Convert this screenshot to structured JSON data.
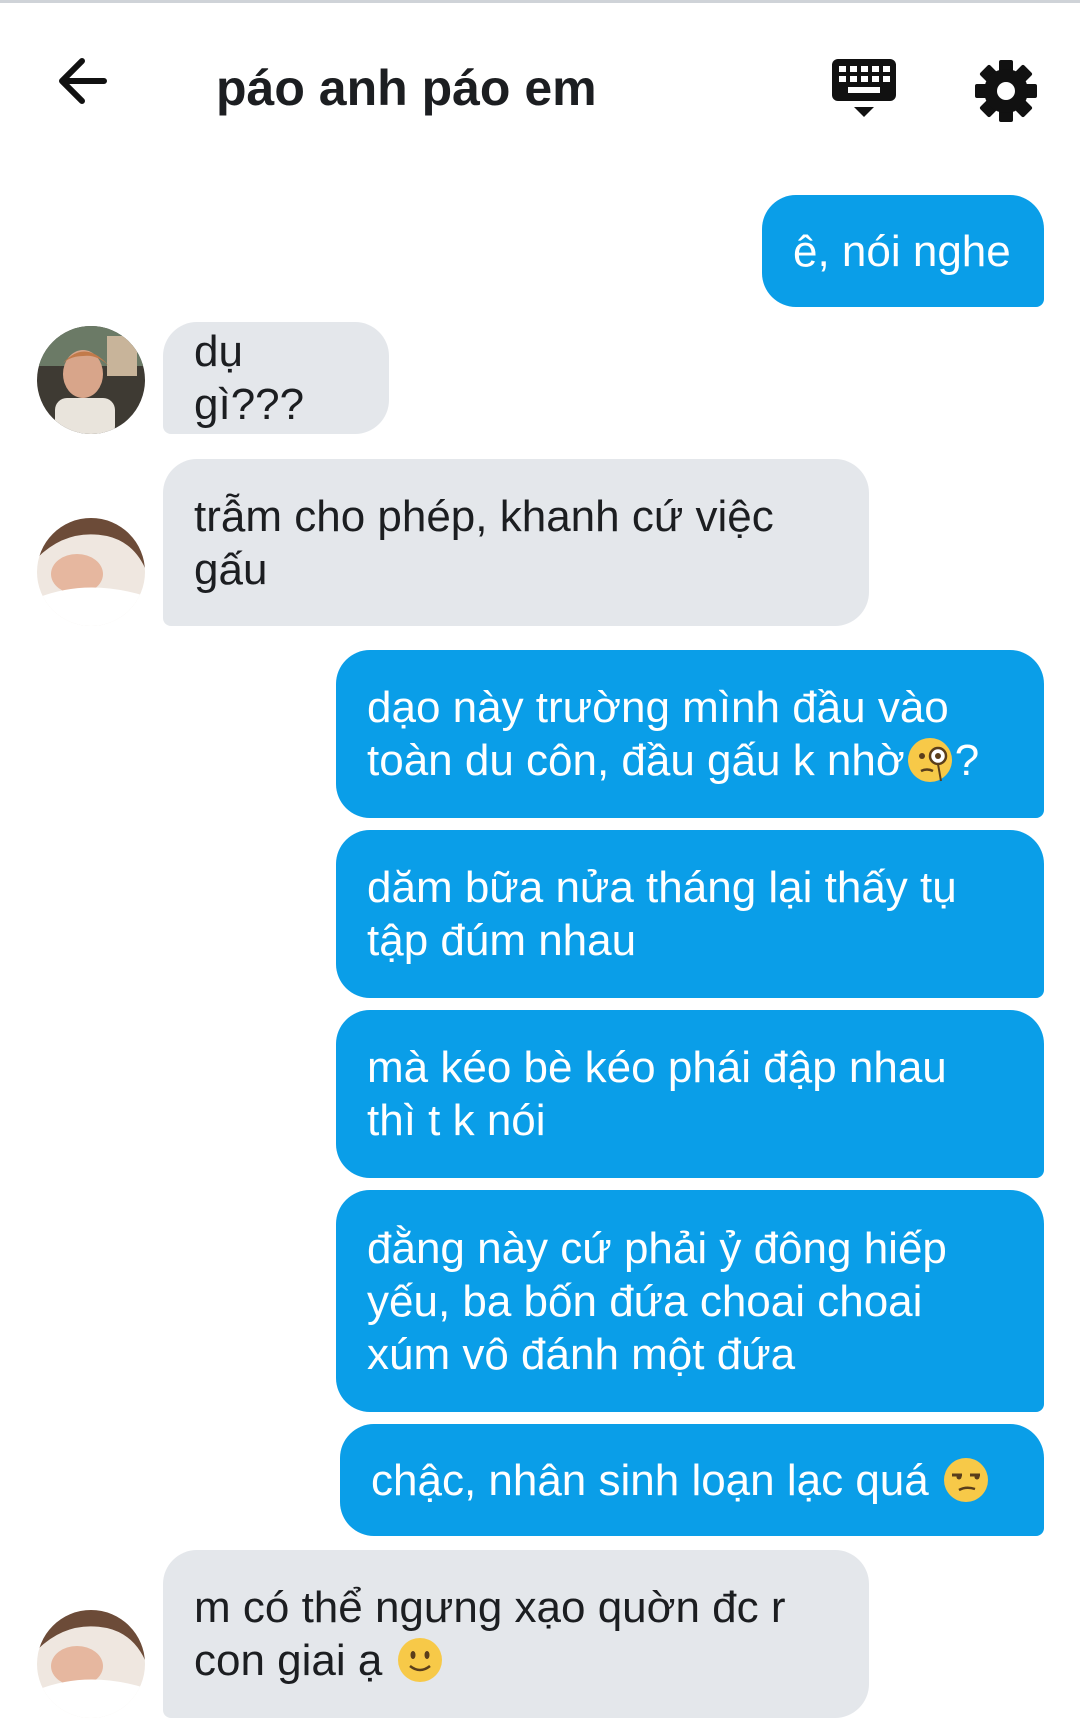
{
  "header": {
    "title": "páo anh páo em",
    "back_icon": "arrow-left-icon",
    "keyboard_icon": "keyboard-icon",
    "settings_icon": "gear-icon"
  },
  "colors": {
    "outgoing_bubble": "#0a9ee8",
    "incoming_bubble": "#e4e7eb"
  },
  "messages": [
    {
      "side": "out",
      "text": "ê, nói nghe"
    },
    {
      "side": "in",
      "text": "dụ gì???"
    },
    {
      "side": "in",
      "text": "trẫm cho phép, khanh cứ việc\ngấu"
    },
    {
      "side": "out",
      "text": "dạo này trường mình đầu vào\ntoàn du côn, đầu gấu k nhờ",
      "emoji_after": "face-with-monocle",
      "suffix": "?"
    },
    {
      "side": "out",
      "text": "dăm bữa nửa tháng lại thấy tụ\ntập đúm nhau"
    },
    {
      "side": "out",
      "text": "mà kéo bè kéo phái đập nhau\nthì t k nói"
    },
    {
      "side": "out",
      "text": "đằng này cứ phải ỷ đông hiếp\nyếu, ba bốn đứa choai choai\nxúm vô đánh một đứa"
    },
    {
      "side": "out",
      "text": "chậc, nhân sinh loạn lạc quá",
      "emoji_after": "unamused-face"
    },
    {
      "side": "in",
      "text": "m có thể ngưng xạo quờn đc r\ncon giai ạ",
      "emoji_after": "slightly-smiling-face"
    }
  ]
}
